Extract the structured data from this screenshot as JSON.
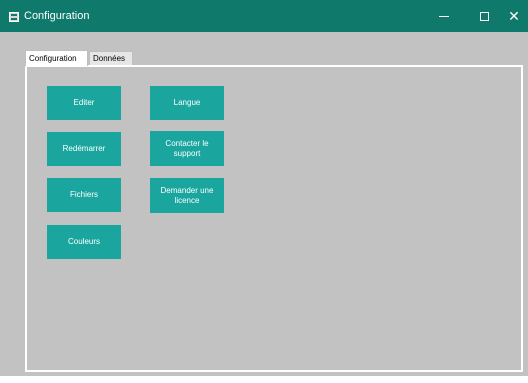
{
  "window": {
    "title": "Configuration",
    "controls": {
      "minimize": "—",
      "maximize": "☐",
      "close": "✕"
    },
    "colors": {
      "titlebar": "#0f7a6c",
      "button": "#1aa59e",
      "background": "#c2c2c2"
    }
  },
  "tabs": [
    {
      "label": "Configuration",
      "selected": true
    },
    {
      "label": "Données",
      "selected": false
    }
  ],
  "buttons": {
    "edit": "Editer",
    "restart": "Redémarrer",
    "files": "Fichiers",
    "colors": "Couleurs",
    "language": "Langue",
    "contact_support": "Contacter le support",
    "request_license": "Demander une licence"
  }
}
